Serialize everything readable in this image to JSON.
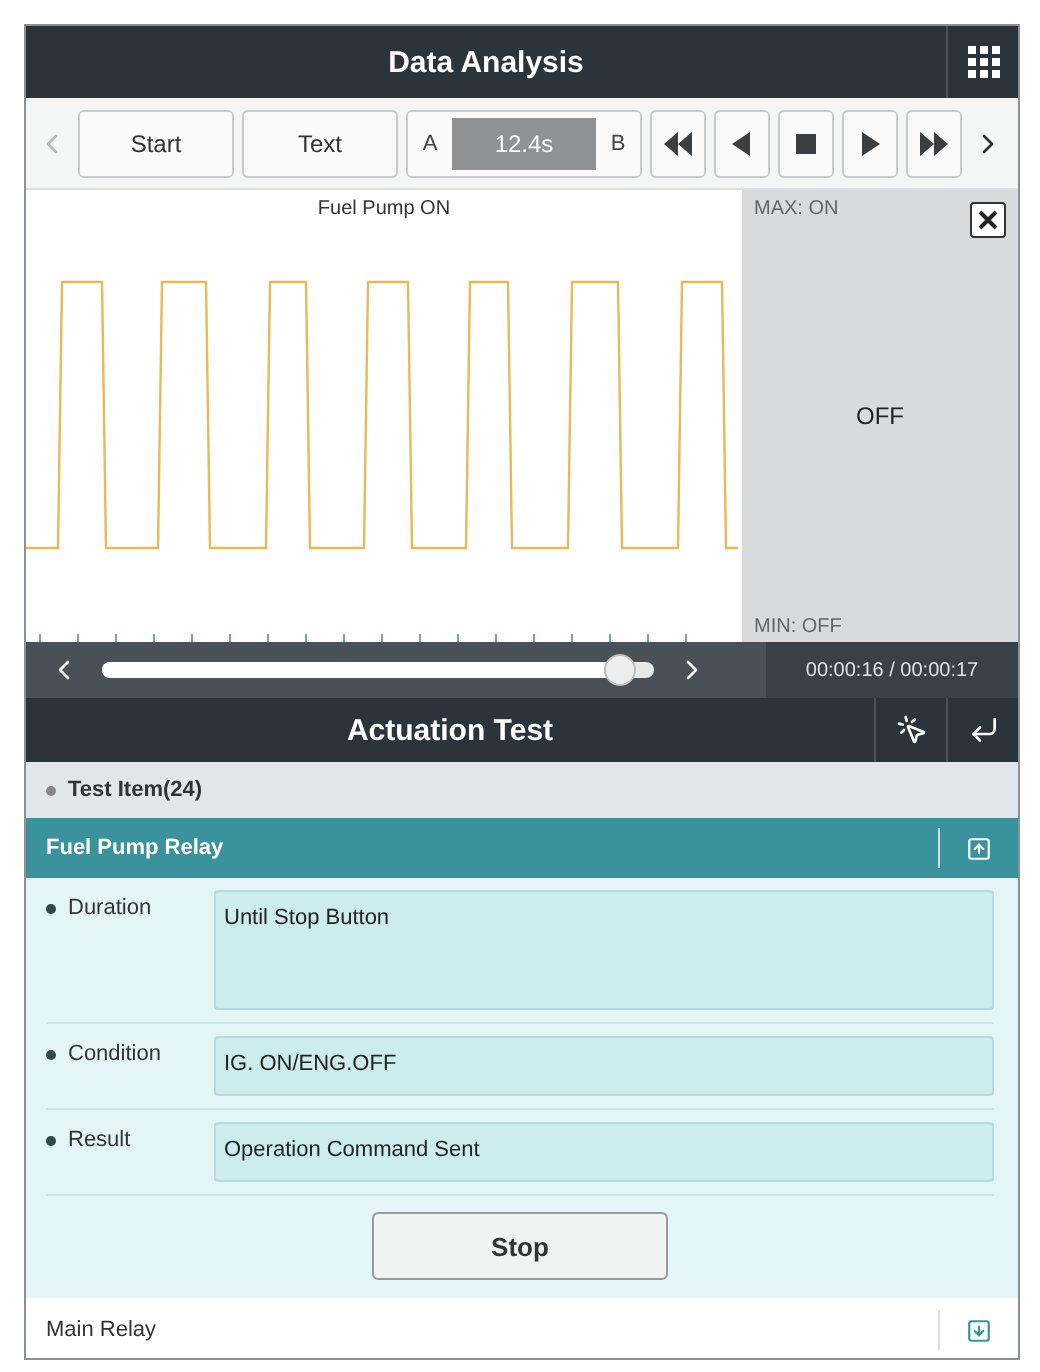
{
  "window": {
    "title": "Data Analysis"
  },
  "toolbar": {
    "buttons": [
      "Start",
      "Text"
    ],
    "range": {
      "a": "A",
      "value": "12.4s",
      "b": "B"
    }
  },
  "graph": {
    "title": "Fuel Pump ON",
    "max_label": "MAX: ON",
    "min_label": "MIN: OFF",
    "current_value": "OFF"
  },
  "scrubber": {
    "level": 0.94,
    "time": "00:00:16 / 00:00:17"
  },
  "actuation": {
    "title": "Actuation Test",
    "list_header": "Test Item(24)",
    "items": [
      {
        "name": "Fuel Pump Relay",
        "expanded": true,
        "fields": [
          {
            "label": "Duration",
            "value": "Until Stop Button",
            "tall": true
          },
          {
            "label": "Condition",
            "value": "IG. ON/ENG.OFF",
            "tall": false
          },
          {
            "label": "Result",
            "value": "Operation Command Sent",
            "tall": false
          }
        ],
        "button": "Stop"
      },
      {
        "name": "Main Relay",
        "expanded": false
      }
    ]
  }
}
